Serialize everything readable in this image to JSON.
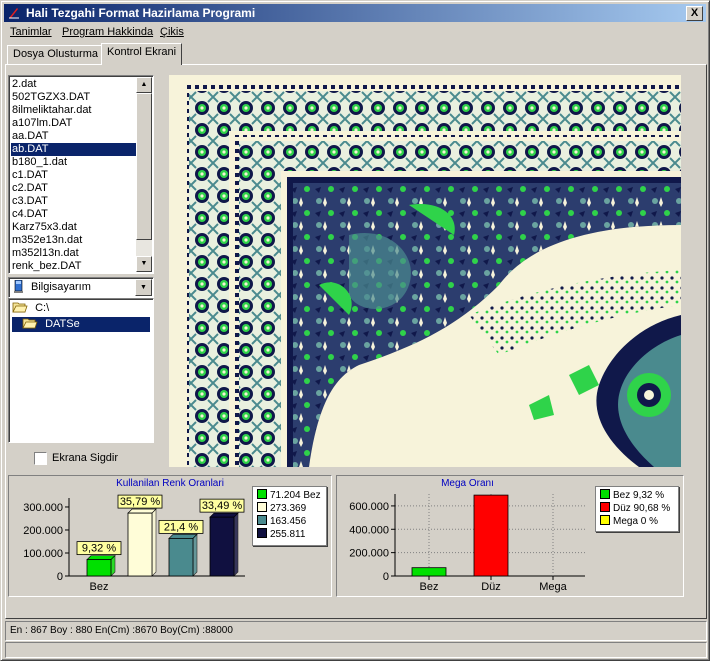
{
  "window": {
    "title": "Hali Tezgahi Format Hazirlama Programi",
    "close_glyph": "X"
  },
  "menu": [
    {
      "label": "Tanimlar"
    },
    {
      "label": "Program Hakkinda"
    },
    {
      "label": "Çikis"
    }
  ],
  "tabs": [
    {
      "label": "Dosya Olusturma",
      "active": false
    },
    {
      "label": "Kontrol Ekrani",
      "active": true
    }
  ],
  "files": [
    "2.dat",
    "502TGZX3.DAT",
    "8ilmeliktahar.dat",
    "a107lm.DAT",
    "aa.DAT",
    "ab.DAT",
    "b180_1.dat",
    "c1.DAT",
    "c2.DAT",
    "c3.DAT",
    "c4.DAT",
    "Karz75x3.dat",
    "m352e13n.dat",
    "m352l13n.dat",
    "renk_bez.DAT"
  ],
  "selected_file": "ab.DAT",
  "drive": {
    "label": "Bilgisayarım",
    "icon": "computer-icon"
  },
  "dirs": [
    {
      "label": "C:\\",
      "icon": "open-folder-icon"
    },
    {
      "label": "DATSe",
      "icon": "open-folder-icon",
      "selected": true
    }
  ],
  "fit_checkbox": {
    "label": "Ekrana Sigdir",
    "checked": false
  },
  "chart_data": [
    {
      "type": "bar",
      "title": "Kullanilan Renk Oranlari",
      "categories": [
        "Bez",
        "",
        "",
        ""
      ],
      "ylim": [
        0,
        300000
      ],
      "yticks": [
        "0",
        "100.000",
        "200.000",
        "300.000"
      ],
      "series": [
        {
          "value": 71204,
          "label": "9,32 %",
          "color": "#00e000",
          "legend": "71.204 Bez"
        },
        {
          "value": 273369,
          "label": "35,79 %",
          "color": "#fffdd8",
          "legend": "273.369"
        },
        {
          "value": 163456,
          "label": "21,4 %",
          "color": "#4a8a8e",
          "legend": "163.456"
        },
        {
          "value": 255811,
          "label": "33,49 %",
          "color": "#101040",
          "legend": "255.811"
        }
      ],
      "grid": false,
      "legend_position": "right"
    },
    {
      "type": "bar",
      "title": "Mega Oranı",
      "categories": [
        "Bez",
        "Düz",
        "Mega"
      ],
      "ylim": [
        0,
        600000
      ],
      "yticks": [
        "0",
        "200.000",
        "400.000",
        "600.000"
      ],
      "series": [
        {
          "value": 71204,
          "color": "#00e000",
          "legend": "Bez 9,32 %"
        },
        {
          "value": 692636,
          "color": "#ff0000",
          "legend": "Düz 90,68 %"
        },
        {
          "value": 0,
          "color": "#ffff00",
          "legend": "Mega 0 %"
        }
      ],
      "grid": true,
      "legend_position": "right"
    }
  ],
  "status": {
    "text": "En : 867 Boy : 880 En(Cm) :8670 Boy(Cm) :88000"
  },
  "colors": {
    "title_start": "#0a246a",
    "title_end": "#a6caf0",
    "selection": "#0a246a",
    "carpet_green": "#2fd34a",
    "carpet_navy": "#10184a",
    "carpet_teal": "#4a8a8e",
    "carpet_cream": "#f7f3da"
  }
}
